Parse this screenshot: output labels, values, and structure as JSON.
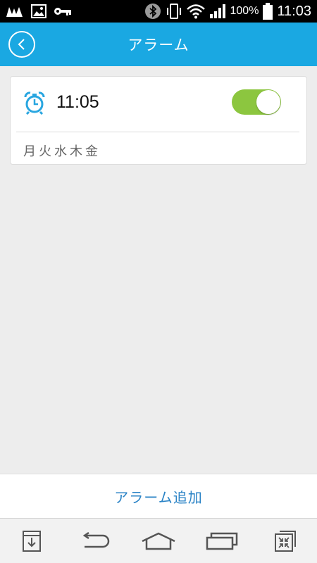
{
  "status_bar": {
    "battery_percent": "100%",
    "time": "11:03"
  },
  "app_bar": {
    "title": "アラーム",
    "back_icon": "back-circle-icon"
  },
  "alarms": [
    {
      "time": "11:05",
      "days": "月火水木金",
      "enabled": true,
      "icon": "alarm-clock-icon"
    }
  ],
  "add_button": {
    "label": "アラーム追加"
  },
  "colors": {
    "app_bar": "#1aa8e2",
    "toggle_on": "#8cc63f",
    "add_label": "#2a83c6"
  },
  "nav_bar": {
    "items": [
      "download-icon",
      "back-arrow-icon",
      "home-icon",
      "recent-apps-icon",
      "shrink-window-icon"
    ]
  }
}
